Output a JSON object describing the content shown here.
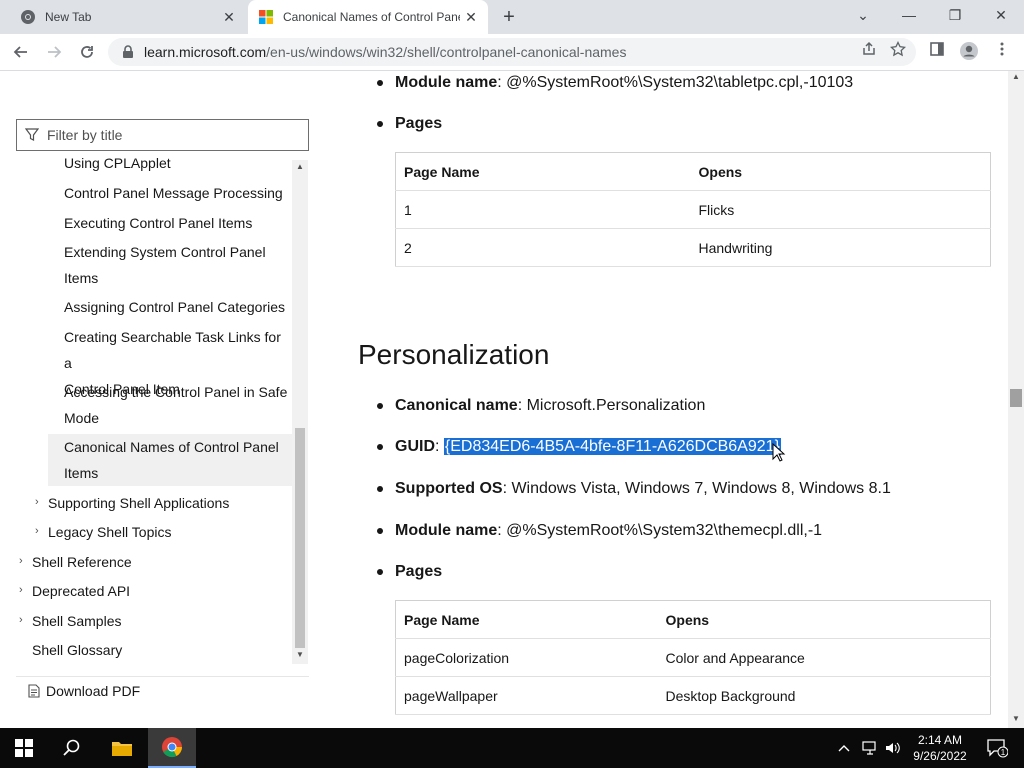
{
  "browser": {
    "tabs": [
      {
        "title": "New Tab",
        "active": false
      },
      {
        "title": "Canonical Names of Control Panel Items",
        "active": true
      }
    ],
    "close_glyph": "✕",
    "new_tab_glyph": "+",
    "url_host": "learn.microsoft.com",
    "url_path": "/en-us/windows/win32/shell/controlpanel-canonical-names",
    "window_controls": {
      "dropdown": "⌄",
      "minimize": "—",
      "maximize": "❐",
      "close": "✕"
    }
  },
  "sidebar": {
    "filter_placeholder": "Filter by title",
    "items": [
      {
        "label": "Using CPLApplet"
      },
      {
        "label": "Control Panel Message Processing"
      },
      {
        "label": "Executing Control Panel Items"
      },
      {
        "label": "Extending System Control Panel",
        "label2": "Items"
      },
      {
        "label": "Assigning Control Panel Categories"
      },
      {
        "label": "Creating Searchable Task Links for a",
        "label2": "Control Panel Item"
      },
      {
        "label": "Accessing the Control Panel in Safe",
        "label2": "Mode"
      },
      {
        "label": "Canonical Names of Control Panel",
        "label2": "Items",
        "selected": true
      },
      {
        "label": "Supporting Shell Applications",
        "expandable": true
      },
      {
        "label": "Legacy Shell Topics",
        "expandable": true
      },
      {
        "label": "Shell Reference",
        "expandable": true
      },
      {
        "label": "Deprecated API",
        "expandable": true
      },
      {
        "label": "Shell Samples",
        "expandable": true
      },
      {
        "label": "Shell Glossary"
      }
    ],
    "download_pdf": "Download PDF"
  },
  "article": {
    "prev": {
      "module_label": "Module name",
      "module_value": "@%SystemRoot%\\System32\\tabletpc.cpl,-10103",
      "pages_label": "Pages",
      "table": {
        "headers": [
          "Page Name",
          "Opens"
        ],
        "rows": [
          [
            "1",
            "Flicks"
          ],
          [
            "2",
            "Handwriting"
          ]
        ]
      }
    },
    "section_title": "Personalization",
    "canonical_label": "Canonical name",
    "canonical_value": "Microsoft.Personalization",
    "guid_label": "GUID",
    "guid_value": "{ED834ED6-4B5A-4bfe-8F11-A626DCB6A921}",
    "os_label": "Supported OS",
    "os_value": "Windows Vista, Windows 7, Windows 8, Windows 8.1",
    "module_label": "Module name",
    "module_value": "@%SystemRoot%\\System32\\themecpl.dll,-1",
    "pages_label": "Pages",
    "table": {
      "headers": [
        "Page Name",
        "Opens"
      ],
      "rows": [
        [
          "pageColorization",
          "Color and Appearance"
        ],
        [
          "pageWallpaper",
          "Desktop Background"
        ]
      ]
    }
  },
  "taskbar": {
    "time": "2:14 AM",
    "date": "9/26/2022",
    "notification_count": "1"
  }
}
